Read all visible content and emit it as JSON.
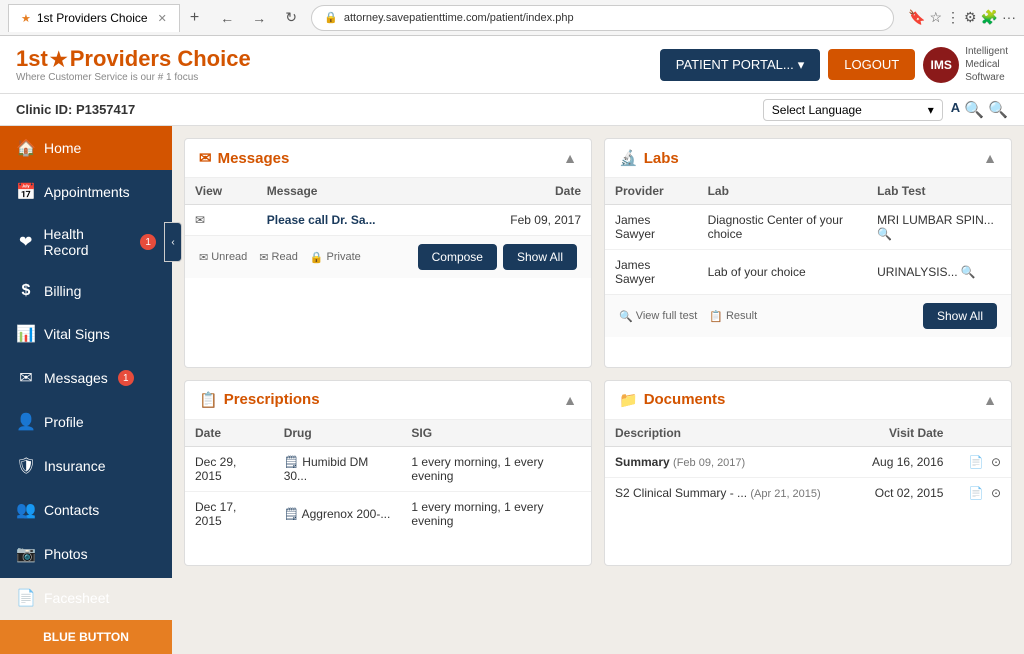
{
  "browser": {
    "tab_title": "1st Providers Choice",
    "url": "attorney.savepatienttime.com/patient/index.php"
  },
  "header": {
    "logo_name": "1st",
    "logo_star": "★",
    "logo_rest": "Providers Choice",
    "logo_sub": "Where Customer Service is our # 1 focus",
    "portal_btn": "PATIENT PORTAL...",
    "logout_btn": "LOGOUT",
    "ims_line1": "Intelligent",
    "ims_line2": "Medical",
    "ims_line3": "Software"
  },
  "clinic_bar": {
    "clinic_id": "Clinic ID: P1357417",
    "lang_select": "Select Language",
    "search_icon": "🔍"
  },
  "sidebar": {
    "items": [
      {
        "id": "home",
        "label": "Home",
        "icon": "🏠",
        "active": true,
        "badge": null
      },
      {
        "id": "appointments",
        "label": "Appointments",
        "icon": "📅",
        "active": false,
        "badge": null
      },
      {
        "id": "health-record",
        "label": "Health Record",
        "icon": "❤",
        "active": false,
        "badge": 1
      },
      {
        "id": "billing",
        "label": "Billing",
        "icon": "$",
        "active": false,
        "badge": null
      },
      {
        "id": "vital-signs",
        "label": "Vital Signs",
        "icon": "📊",
        "active": false,
        "badge": null
      },
      {
        "id": "messages",
        "label": "Messages",
        "icon": "✉",
        "active": false,
        "badge": 1
      },
      {
        "id": "profile",
        "label": "Profile",
        "icon": "👤",
        "active": false,
        "badge": null
      },
      {
        "id": "insurance",
        "label": "Insurance",
        "icon": "🛡",
        "active": false,
        "badge": null
      },
      {
        "id": "contacts",
        "label": "Contacts",
        "icon": "👥",
        "active": false,
        "badge": null
      },
      {
        "id": "photos",
        "label": "Photos",
        "icon": "📷",
        "active": false,
        "badge": null
      },
      {
        "id": "facesheet",
        "label": "Facesheet",
        "icon": "📄",
        "active": false,
        "badge": null
      }
    ],
    "blue_button": "BLUE BUTTON"
  },
  "messages_card": {
    "title": "Messages",
    "icon": "✉",
    "columns": [
      "View",
      "Message",
      "Date"
    ],
    "rows": [
      {
        "view": "✉",
        "message": "Please call Dr. Sa...",
        "date": "Feb 09, 2017"
      }
    ],
    "footer": {
      "unread": "Unread",
      "read": "Read",
      "private": "Private",
      "compose_btn": "Compose",
      "show_all_btn": "Show All"
    }
  },
  "labs_card": {
    "title": "Labs",
    "icon": "🔬",
    "columns": [
      "Provider",
      "Lab",
      "Lab Test"
    ],
    "rows": [
      {
        "provider": "James Sawyer",
        "lab": "Diagnostic Center of your choice",
        "lab_test": "MRI LUMBAR SPIN...🔍"
      },
      {
        "provider": "James Sawyer",
        "lab": "Lab of your choice",
        "lab_test": "URINALYSIS...🔍"
      }
    ],
    "footer": {
      "view_full_test": "View full test",
      "result": "Result",
      "show_all_btn": "Show All"
    }
  },
  "prescriptions_card": {
    "title": "Prescriptions",
    "icon": "📋",
    "columns": [
      "Date",
      "Drug",
      "SIG"
    ],
    "rows": [
      {
        "date": "Dec 29, 2015",
        "drug": "🗒 Humibid DM 30...",
        "sig": "1 every morning, 1 every evening"
      },
      {
        "date": "Dec 17, 2015",
        "drug": "🗒 Aggrenox 200-...",
        "sig": "1 every morning, 1 every evening"
      }
    ]
  },
  "documents_card": {
    "title": "Documents",
    "icon": "📁",
    "columns": [
      "Description",
      "Visit Date"
    ],
    "rows": [
      {
        "description": "Summary",
        "desc_date": "(Feb 09, 2017)",
        "visit_date": "Aug 16, 2016",
        "icons": "📄⊙"
      },
      {
        "description": "S2 Clinical Summary - ...",
        "desc_date": "(Apr 21, 2015)",
        "visit_date": "Oct 02, 2015",
        "icons": "📄⊙"
      }
    ]
  }
}
